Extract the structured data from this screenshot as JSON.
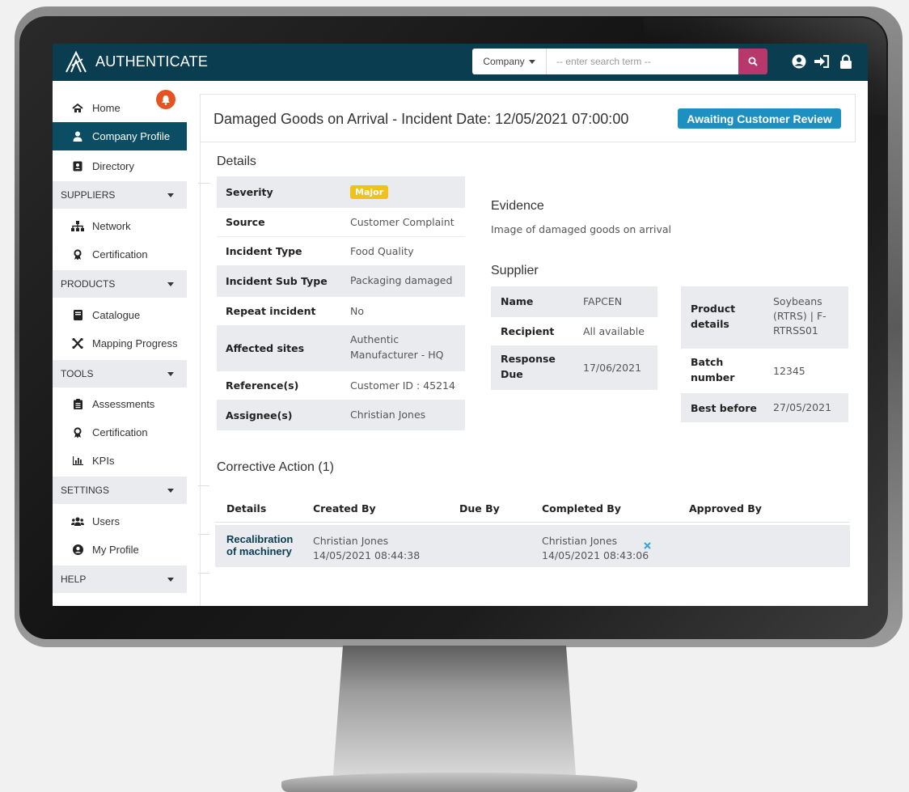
{
  "app": {
    "name": "AUTHENTICATE"
  },
  "search": {
    "scope": "Company",
    "placeholder": "-- enter search term --"
  },
  "sidebar": {
    "home": "Home",
    "company_profile": "Company Profile",
    "directory": "Directory",
    "suppliers_section": "SUPPLIERS",
    "network": "Network",
    "certification": "Certification",
    "products_section": "PRODUCTS",
    "catalogue": "Catalogue",
    "mapping_progress": "Mapping Progress",
    "tools_section": "TOOLS",
    "assessments": "Assessments",
    "tools_certification": "Certification",
    "kpis": "KPIs",
    "settings_section": "SETTINGS",
    "users": "Users",
    "my_profile": "My Profile",
    "help_section": "HELP"
  },
  "incident": {
    "title": "Damaged Goods on Arrival - Incident Date: 12/05/2021 07:00:00",
    "status": "Awaiting Customer Review"
  },
  "details": {
    "heading": "Details",
    "severity_label": "Severity",
    "severity_value": "Major",
    "source_label": "Source",
    "source_value": "Customer Complaint",
    "type_label": "Incident Type",
    "type_value": "Food Quality",
    "subtype_label": "Incident Sub Type",
    "subtype_value": "Packaging damaged",
    "repeat_label": "Repeat incident",
    "repeat_value": "No",
    "sites_label": "Affected sites",
    "sites_value_1": "Authentic",
    "sites_value_2": "Manufacturer - HQ",
    "ref_label": "Reference(s)",
    "ref_value": "Customer ID : 45214",
    "assignee_label": "Assignee(s)",
    "assignee_value": "Christian Jones"
  },
  "evidence": {
    "heading": "Evidence",
    "text": "Image of damaged goods on arrival"
  },
  "supplier": {
    "heading": "Supplier",
    "name_label": "Name",
    "name_value": "FAPCEN",
    "recipient_label": "Recipient",
    "recipient_value": "All available",
    "response_label_1": "Response",
    "response_label_2": "Due",
    "response_value": "17/06/2021",
    "product_label_1": "Product",
    "product_label_2": "details",
    "product_value_1": "Soybeans",
    "product_value_2": "(RTRS) | F-",
    "product_value_3": "RTRSS01",
    "batch_label_1": "Batch",
    "batch_label_2": "number",
    "batch_value": "12345",
    "best_before_label": "Best before",
    "best_before_value": "27/05/2021"
  },
  "corrective": {
    "heading": "Corrective Action (1)",
    "columns": {
      "details": "Details",
      "created_by": "Created By",
      "due_by": "Due By",
      "completed_by": "Completed By",
      "approved_by": "Approved By"
    },
    "row": {
      "details_1": "Recalibration",
      "details_2": "of machinery",
      "created_name": "Christian Jones",
      "created_date": "14/05/2021 08:44:38",
      "completed_name": "Christian Jones",
      "completed_date": "14/05/2021 08:43:06"
    }
  },
  "colors": {
    "topbar": "#0b3d51",
    "accent_badge": "#1e8fc1",
    "search_button": "#b8386e",
    "notification": "#e55322",
    "severity_major": "#f0c11b"
  }
}
